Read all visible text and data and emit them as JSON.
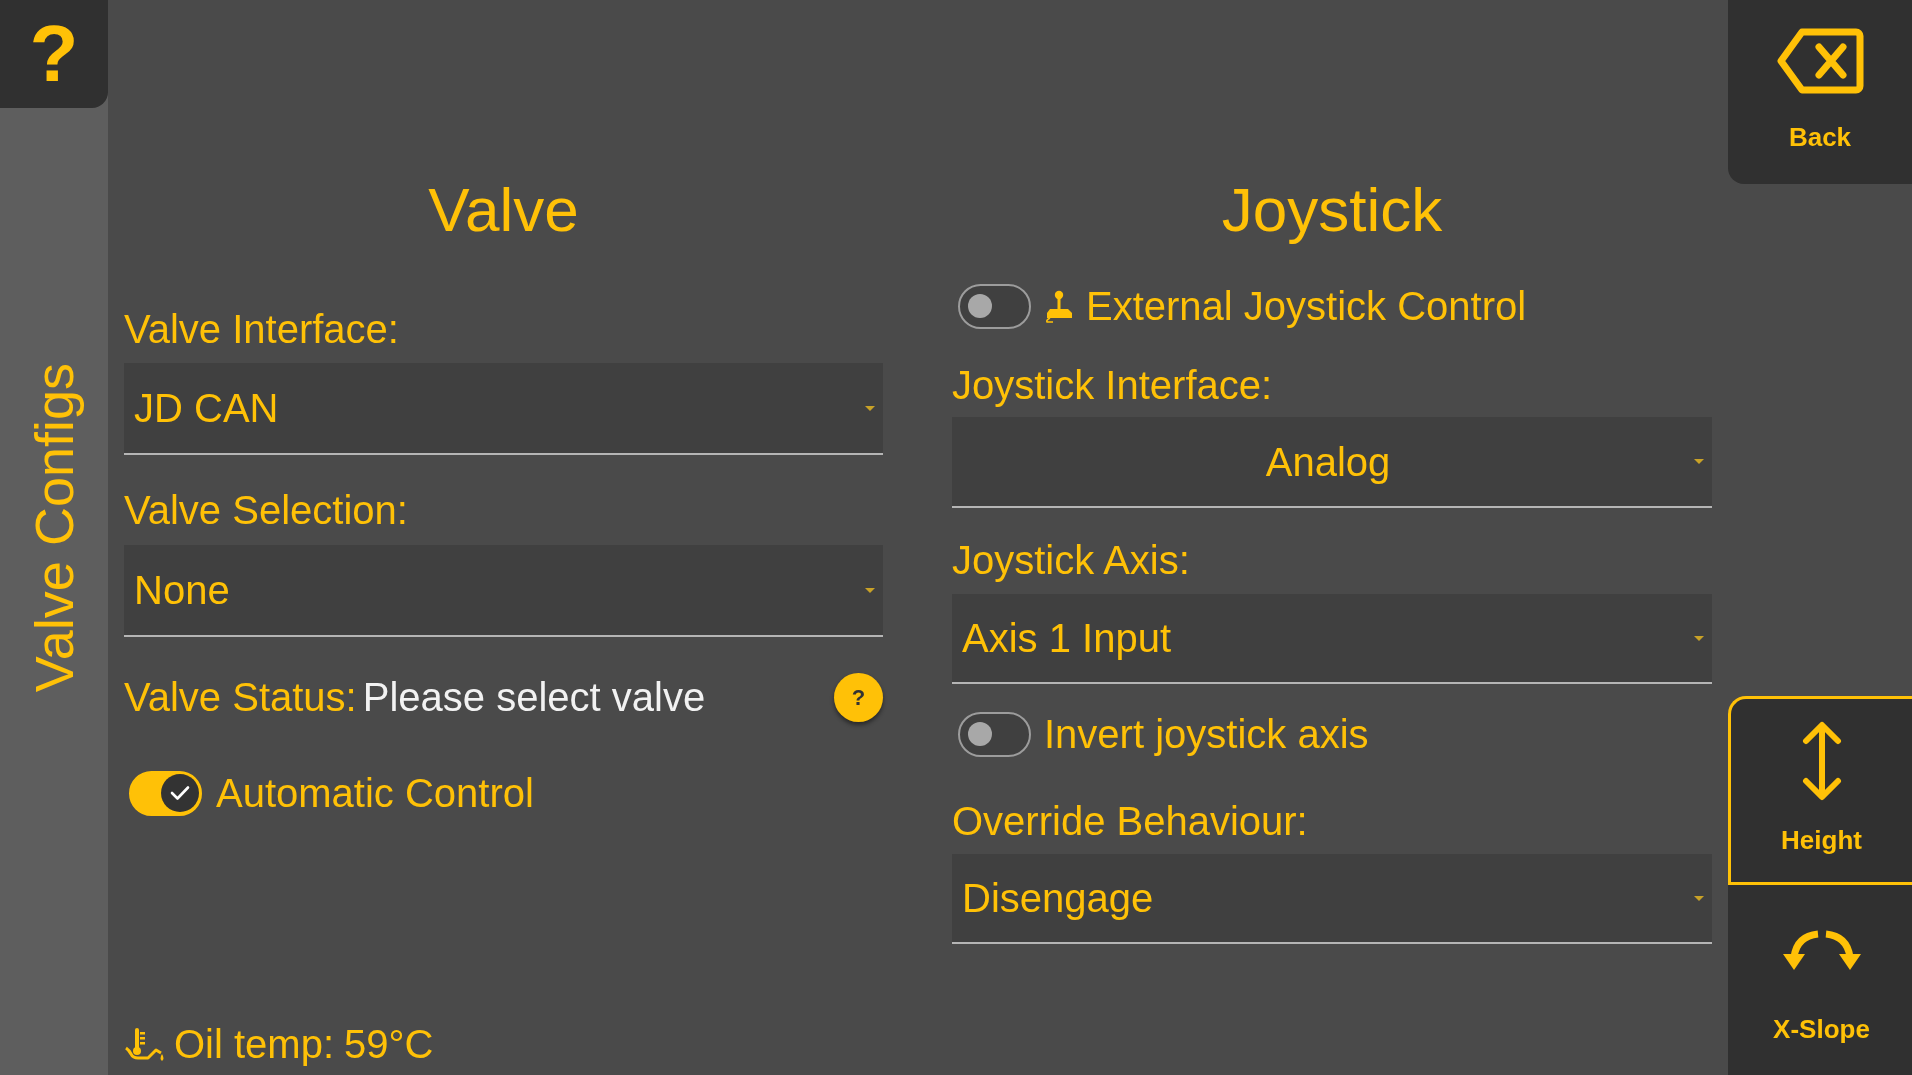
{
  "help_button": {
    "label": "?"
  },
  "sidebar": {
    "title": "Valve Configs"
  },
  "valve": {
    "title": "Valve",
    "interface": {
      "label": "Valve Interface:",
      "value": "JD CAN"
    },
    "selection": {
      "label": "Valve Selection:",
      "value": "None"
    },
    "status": {
      "label": "Valve Status:",
      "value": "Please select valve",
      "help": "?"
    },
    "automatic_control": {
      "label": "Automatic Control",
      "on": true
    }
  },
  "joystick": {
    "title": "Joystick",
    "external_control": {
      "label": "External Joystick Control",
      "on": false
    },
    "interface": {
      "label": "Joystick Interface:",
      "value": "Analog"
    },
    "axis": {
      "label": "Joystick Axis:",
      "value": "Axis 1 Input"
    },
    "invert_axis": {
      "label": "Invert joystick axis",
      "on": false
    },
    "override": {
      "label": "Override Behaviour:",
      "value": "Disengage"
    }
  },
  "oil_temp": {
    "label": "Oil temp:",
    "value": "59°C"
  },
  "back_button": {
    "label": "Back"
  },
  "modes": [
    {
      "kind": "height",
      "label": "Height",
      "selected": true
    },
    {
      "kind": "slope",
      "label": "X-Slope",
      "selected": false
    }
  ]
}
